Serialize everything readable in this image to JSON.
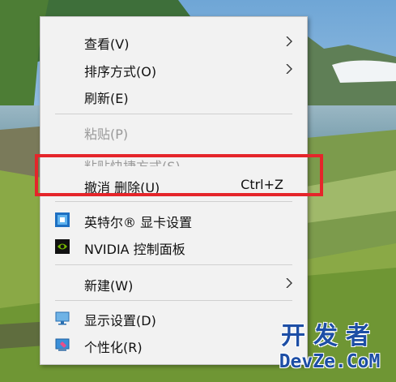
{
  "context_menu": {
    "items": [
      {
        "label": "查看(V)",
        "submenu": true
      },
      {
        "label": "排序方式(O)",
        "submenu": true
      },
      {
        "label": "刷新(E)"
      },
      {
        "label": "粘贴(P)",
        "disabled": true
      },
      {
        "label": "粘贴快捷方式(S)",
        "disabled": true
      },
      {
        "label": "撤消 删除(U)",
        "shortcut": "Ctrl+Z"
      },
      {
        "label": "英特尔® 显卡设置",
        "icon": "intel-graphics-icon"
      },
      {
        "label": "NVIDIA 控制面板",
        "icon": "nvidia-icon"
      },
      {
        "label": "新建(W)",
        "submenu": true
      },
      {
        "label": "显示设置(D)",
        "icon": "display-settings-icon"
      },
      {
        "label": "个性化(R)",
        "icon": "personalize-icon"
      }
    ]
  },
  "watermark": {
    "top": "开发者",
    "bottom": "DevZe.CoM"
  },
  "colors": {
    "highlight_border": "#e5252a",
    "menu_bg": "#f2f2f2",
    "watermark": "#1d4ea5"
  }
}
